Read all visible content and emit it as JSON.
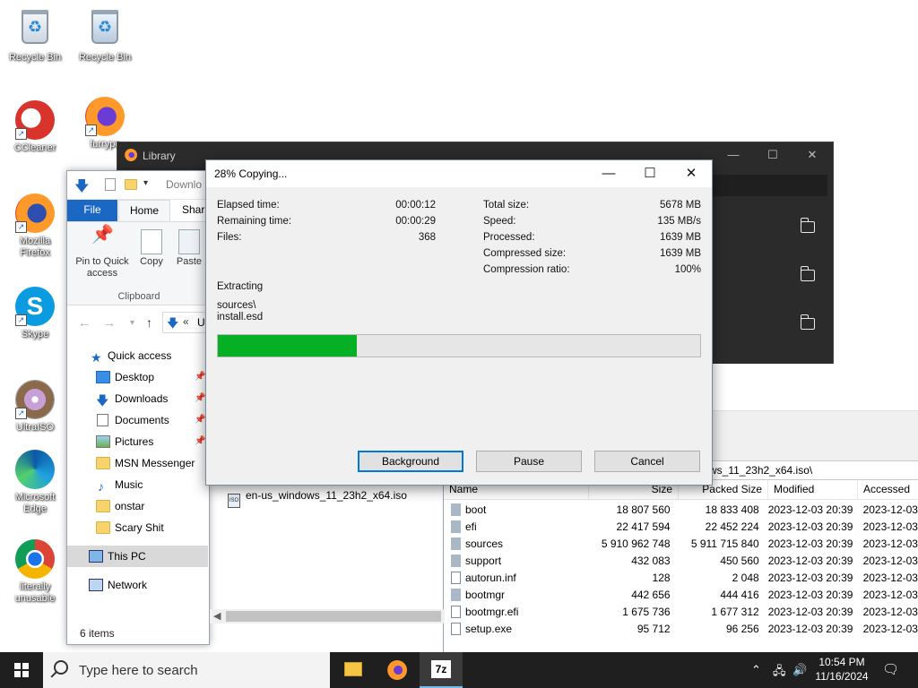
{
  "desktop": {
    "icons": [
      {
        "label": "Recycle Bin"
      },
      {
        "label": "Recycle Bin"
      },
      {
        "label": "CCleaner"
      },
      {
        "label": "furrypc"
      },
      {
        "label": "Mozilla\nFirefox"
      },
      {
        "label": "Skype"
      },
      {
        "label": "UltraISO"
      },
      {
        "label": "Microsoft\nEdge"
      },
      {
        "label": "literally\nunusable"
      }
    ]
  },
  "library_window": {
    "title": "Library"
  },
  "explorer": {
    "address_partial": "Downlo",
    "tabs": {
      "file": "File",
      "home": "Home",
      "share": "Shar"
    },
    "ribbon": {
      "pin": "Pin to Quick access",
      "copy": "Copy",
      "paste": "Paste",
      "group": "Clipboard"
    },
    "nav_address": "U",
    "nav_items": [
      "Quick access",
      "Desktop",
      "Downloads",
      "Documents",
      "Pictures",
      "MSN Messenger",
      "Music",
      "onstar",
      "Scary Shit",
      "This PC",
      "Network"
    ],
    "status": "6 items",
    "file": "en-us_windows_11_23h2_x64.iso"
  },
  "zip_manager": {
    "path": "ws_11_23h2_x64.iso\\",
    "headers": [
      "Name",
      "Size",
      "Packed Size",
      "Modified",
      "Accessed"
    ],
    "rows": [
      {
        "name": "boot",
        "size": "18 807 560",
        "packed": "18 833 408",
        "modified": "2023-12-03 20:39",
        "accessed": "2023-12-03"
      },
      {
        "name": "efi",
        "size": "22 417 594",
        "packed": "22 452 224",
        "modified": "2023-12-03 20:39",
        "accessed": "2023-12-03"
      },
      {
        "name": "sources",
        "size": "5 910 962 748",
        "packed": "5 911 715 840",
        "modified": "2023-12-03 20:39",
        "accessed": "2023-12-03"
      },
      {
        "name": "support",
        "size": "432 083",
        "packed": "450 560",
        "modified": "2023-12-03 20:39",
        "accessed": "2023-12-03"
      },
      {
        "name": "autorun.inf",
        "size": "128",
        "packed": "2 048",
        "modified": "2023-12-03 20:39",
        "accessed": "2023-12-03"
      },
      {
        "name": "bootmgr",
        "size": "442 656",
        "packed": "444 416",
        "modified": "2023-12-03 20:39",
        "accessed": "2023-12-03"
      },
      {
        "name": "bootmgr.efi",
        "size": "1 675 736",
        "packed": "1 677 312",
        "modified": "2023-12-03 20:39",
        "accessed": "2023-12-03"
      },
      {
        "name": "setup.exe",
        "size": "95 712",
        "packed": "96 256",
        "modified": "2023-12-03 20:39",
        "accessed": "2023-12-03"
      }
    ]
  },
  "copy_dialog": {
    "title": "28% Copying...",
    "elapsed_label": "Elapsed time:",
    "elapsed": "00:00:12",
    "remaining_label": "Remaining time:",
    "remaining": "00:00:29",
    "files_label": "Files:",
    "files": "368",
    "total_label": "Total size:",
    "total": "5678 MB",
    "speed_label": "Speed:",
    "speed": "135 MB/s",
    "processed_label": "Processed:",
    "processed": "1639 MB",
    "compressed_label": "Compressed size:",
    "compressed": "1639 MB",
    "ratio_label": "Compression ratio:",
    "ratio": "100%",
    "operation": "Extracting",
    "path_line1": "sources\\",
    "path_line2": "install.esd",
    "progress": 0.289,
    "buttons": {
      "background": "Background",
      "pause": "Pause",
      "cancel": "Cancel"
    }
  },
  "taskbar": {
    "search_placeholder": "Type here to search",
    "time": "10:54 PM",
    "date": "11/16/2024"
  },
  "colors": {
    "progress_fill": "#06b025",
    "accent": "#0078d7",
    "file_tab": "#1a68c4"
  }
}
